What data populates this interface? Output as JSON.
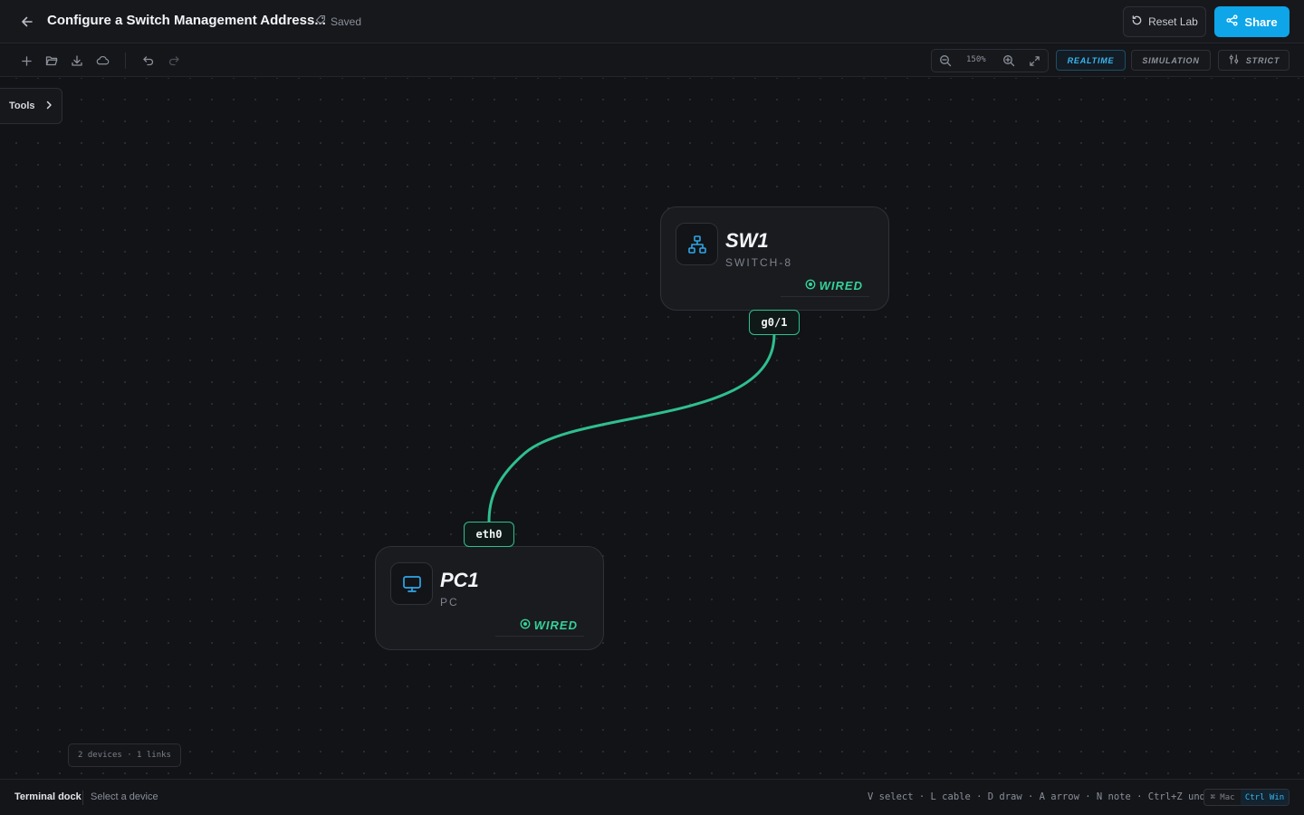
{
  "header": {
    "title": "Configure a Switch Management Address...",
    "saved_label": "Saved",
    "reset_label": "Reset Lab",
    "share_label": "Share"
  },
  "toolbar": {
    "zoom_level": "150%",
    "modes": [
      {
        "label": "REALTIME",
        "active": true
      },
      {
        "label": "SIMULATION",
        "active": false
      },
      {
        "label": "STRICT",
        "active": false
      }
    ]
  },
  "tools_panel": {
    "label": "Tools"
  },
  "devices": [
    {
      "name": "SW1",
      "type": "SWITCH-8",
      "status": "WIRED",
      "icon": "network-switch-icon"
    },
    {
      "name": "PC1",
      "type": "PC",
      "status": "WIRED",
      "icon": "monitor-icon"
    }
  ],
  "links": [
    {
      "from_port": "g0/1",
      "to_port": "eth0",
      "color": "#2fbf8f"
    }
  ],
  "stats": "2 devices · 1 links",
  "footer": {
    "dock_title": "Terminal dock",
    "dock_status": "Select a device",
    "shortcuts": "V select · L cable · D draw · A arrow · N note · Ctrl+Z undo",
    "os_mac": "⌘ Mac",
    "os_win": "Ctrl Win"
  },
  "colors": {
    "accent": "#0ea5e9",
    "wired": "#34d399",
    "link": "#2fbf8f",
    "background": "#121317"
  }
}
